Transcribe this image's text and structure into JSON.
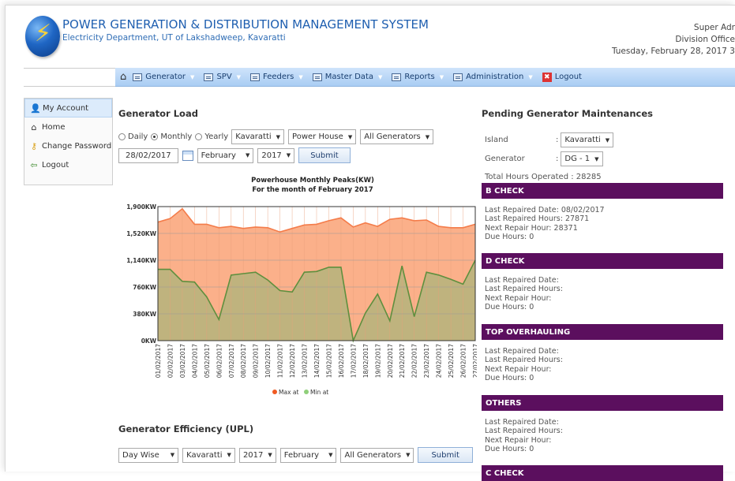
{
  "header": {
    "title": "POWER GENERATION & DISTRIBUTION MANAGEMENT SYSTEM",
    "subtitle": "Electricity Department, UT of Lakshadweep, Kavaratti",
    "user_role": "Super Adr",
    "user_office": "Division Office",
    "date": "Tuesday, February 28, 2017 3"
  },
  "nav": {
    "home_icon": "home-icon",
    "items": [
      {
        "label": "Generator"
      },
      {
        "label": "SPV"
      },
      {
        "label": "Feeders"
      },
      {
        "label": "Master Data"
      },
      {
        "label": "Reports"
      },
      {
        "label": "Administration"
      }
    ],
    "logout": "Logout"
  },
  "sidebar": {
    "items": [
      {
        "label": "My Account",
        "icon": "user-icon"
      },
      {
        "label": "Home",
        "icon": "home-icon"
      },
      {
        "label": "Change Password",
        "icon": "key-icon"
      },
      {
        "label": "Logout",
        "icon": "exit-icon"
      }
    ]
  },
  "generator_load": {
    "title": "Generator Load",
    "radios": [
      {
        "label": "Daily",
        "checked": false
      },
      {
        "label": "Monthly",
        "checked": true
      },
      {
        "label": "Yearly",
        "checked": false
      }
    ],
    "island": "Kavaratti",
    "location": "Power House",
    "generators": "All Generators",
    "date_value": "28/02/2017",
    "month": "February",
    "year": "2017",
    "submit": "Submit"
  },
  "chart_data": {
    "type": "area",
    "title": "Powerhouse Monthly Peaks(KW)",
    "subtitle": "For the month of February 2017",
    "ylim": [
      0,
      1900
    ],
    "yticks": [
      "0KW",
      "380KW",
      "760KW",
      "1,140KW",
      "1,520KW",
      "1,900KW"
    ],
    "categories": [
      "01/02/2017",
      "02/02/2017",
      "03/02/2017",
      "04/02/2017",
      "05/02/2017",
      "06/02/2017",
      "07/02/2017",
      "08/02/2017",
      "09/02/2017",
      "10/02/2017",
      "11/02/2017",
      "12/02/2017",
      "13/02/2017",
      "14/02/2017",
      "15/02/2017",
      "16/02/2017",
      "17/02/2017",
      "18/02/2017",
      "19/02/2017",
      "20/02/2017",
      "21/02/2017",
      "22/02/2017",
      "23/02/2017",
      "24/02/2017",
      "25/02/2017",
      "26/02/2017",
      "27/02/2017"
    ],
    "series": [
      {
        "name": "Max at",
        "color": "#f47c4a",
        "fill": "#fbb08a",
        "values": [
          1680,
          1730,
          1870,
          1650,
          1650,
          1600,
          1620,
          1590,
          1610,
          1600,
          1540,
          1590,
          1640,
          1650,
          1700,
          1740,
          1610,
          1670,
          1620,
          1720,
          1740,
          1700,
          1710,
          1620,
          1600,
          1600,
          1650
        ]
      },
      {
        "name": "Min at",
        "color": "#5f8f3e",
        "fill": "#bfb37e",
        "values": [
          1010,
          1010,
          840,
          830,
          620,
          300,
          930,
          950,
          970,
          860,
          710,
          690,
          970,
          980,
          1040,
          1040,
          0,
          390,
          660,
          280,
          1060,
          340,
          970,
          930,
          870,
          800,
          1140
        ]
      }
    ],
    "grid": true,
    "legend": "bottom-center"
  },
  "generator_efficiency": {
    "title": "Generator Efficiency (UPL)",
    "mode": "Day Wise",
    "island": "Kavaratti",
    "year": "2017",
    "month": "February",
    "generators": "All Generators",
    "submit": "Submit"
  },
  "maintenance": {
    "title": "Pending Generator Maintenances",
    "island_label": "Island",
    "island_value": "Kavaratti",
    "generator_label": "Generator",
    "generator_value": "DG - 1",
    "total_hours": "Total Hours Operated : 28285",
    "sections": [
      {
        "name": "B CHECK",
        "lines": [
          "Last Repaired Date: 08/02/2017",
          "Last Repaired Hours: 27871",
          "Next Repair Hour: 28371",
          "Due Hours: 0"
        ]
      },
      {
        "name": "D CHECK",
        "lines": [
          "Last Repaired Date:",
          "Last Repaired Hours:",
          "Next Repair Hour:",
          "Due Hours: 0"
        ]
      },
      {
        "name": "TOP OVERHAULING",
        "lines": [
          "Last Repaired Date:",
          "Last Repaired Hours:",
          "Next Repair Hour:",
          "Due Hours: 0"
        ]
      },
      {
        "name": "OTHERS",
        "lines": [
          "Last Repaired Date:",
          "Last Repaired Hours:",
          "Next Repair Hour:",
          "Due Hours: 0"
        ]
      },
      {
        "name": "C CHECK",
        "lines": []
      }
    ]
  },
  "colors": {
    "nav_bg": "#b9d7f7",
    "section_header": "#5b0f5e",
    "title_blue": "#1f5fb0"
  }
}
